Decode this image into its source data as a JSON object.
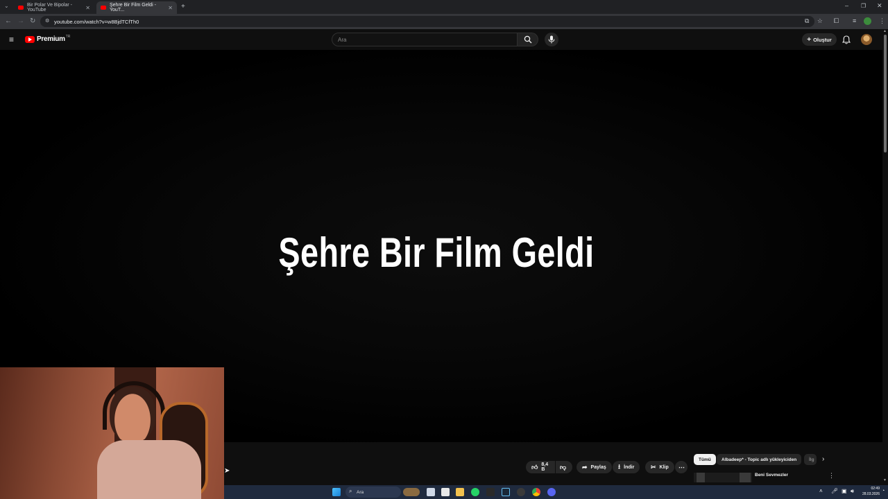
{
  "browser": {
    "tabs": [
      {
        "label": "Bir Polar Ve Bipolar - YouTube",
        "active": false
      },
      {
        "label": "Şehre Bir Film Geldi - YouT...",
        "active": true
      }
    ],
    "url": "youtube.com/watch?v=w8BjdTCfTh0"
  },
  "youtube": {
    "logo_text": "Premium",
    "logo_region": "TR",
    "search_placeholder": "Ara",
    "create_label": "Oluştur"
  },
  "video": {
    "title_overlay": "Şehre Bir Film Geldi"
  },
  "actions": {
    "like_count": "8,4 B",
    "share_label": "Paylaş",
    "download_label": "İndir",
    "clip_label": "Klip"
  },
  "recommendations": {
    "chips": [
      "Tümü",
      "Albadeep* - Topic adlı yükleyiciden",
      "İlg"
    ],
    "first_item_title": "Beni Sevmezler"
  },
  "taskbar": {
    "search_placeholder": "Ara",
    "time": "02:49",
    "date": "28.03.2026"
  },
  "colors": {
    "youtube_red": "#ff0000",
    "background": "#0f0f0f",
    "taskbar": "#1f2a3e"
  }
}
